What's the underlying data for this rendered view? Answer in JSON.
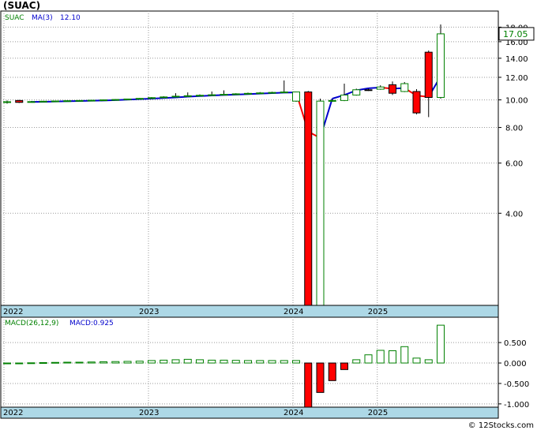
{
  "title": "(SUAC)",
  "watermark": "© 12Stocks.com",
  "colors": {
    "up_fill": "#ffffff",
    "up_stroke": "#008000",
    "down_fill": "#ff0000",
    "ma_up": "#0000cc",
    "ma_down": "#ff0000",
    "macd_pos": "#008000",
    "macd_neg": "#ff0000",
    "axis_band": "#add8e6",
    "price_badge": "#008000"
  },
  "chart_data": [
    {
      "type": "candlestick",
      "name": "price",
      "legend": {
        "ticker": "SUAC",
        "ma_label": "MA(3)",
        "ma_value": "12.10"
      },
      "last_price_label": "17.05",
      "y_scale": "log",
      "ylim": [
        1.9,
        20.5
      ],
      "yticks": [
        4.0,
        6.0,
        8.0,
        10.0,
        12.0,
        14.0,
        16.0,
        18.0
      ],
      "ytick_labels": [
        "4.00",
        "6.00",
        "8.00",
        "10.00",
        "12.00",
        "14.00",
        "16.00",
        "18.00"
      ],
      "grid": true,
      "xtick_labels": [
        "2022",
        "2023",
        "2024",
        "2025"
      ],
      "xtick_index": [
        0,
        12,
        24,
        31
      ],
      "candles": [
        {
          "o": 9.8,
          "h": 9.95,
          "l": 9.7,
          "c": 9.85
        },
        {
          "o": 9.95,
          "h": 10.0,
          "l": 9.75,
          "c": 9.8
        },
        {
          "o": 9.85,
          "h": 9.9,
          "l": 9.8,
          "c": 9.86
        },
        {
          "o": 9.87,
          "h": 9.92,
          "l": 9.84,
          "c": 9.89
        },
        {
          "o": 9.89,
          "h": 9.94,
          "l": 9.86,
          "c": 9.91
        },
        {
          "o": 9.91,
          "h": 9.96,
          "l": 9.88,
          "c": 9.93
        },
        {
          "o": 9.93,
          "h": 9.98,
          "l": 9.9,
          "c": 9.95
        },
        {
          "o": 9.95,
          "h": 10.0,
          "l": 9.92,
          "c": 9.97
        },
        {
          "o": 9.97,
          "h": 10.03,
          "l": 9.94,
          "c": 10.0
        },
        {
          "o": 10.0,
          "h": 10.06,
          "l": 9.97,
          "c": 10.03
        },
        {
          "o": 10.03,
          "h": 10.1,
          "l": 10.0,
          "c": 10.07
        },
        {
          "o": 10.07,
          "h": 10.15,
          "l": 10.04,
          "c": 10.12
        },
        {
          "o": 10.12,
          "h": 10.22,
          "l": 10.08,
          "c": 10.18
        },
        {
          "o": 10.18,
          "h": 10.3,
          "l": 10.14,
          "c": 10.24
        },
        {
          "o": 10.24,
          "h": 10.55,
          "l": 10.2,
          "c": 10.3
        },
        {
          "o": 10.3,
          "h": 10.62,
          "l": 10.26,
          "c": 10.34
        },
        {
          "o": 10.34,
          "h": 10.45,
          "l": 10.3,
          "c": 10.38
        },
        {
          "o": 10.38,
          "h": 10.7,
          "l": 10.34,
          "c": 10.42
        },
        {
          "o": 10.42,
          "h": 10.8,
          "l": 10.38,
          "c": 10.46
        },
        {
          "o": 10.46,
          "h": 10.55,
          "l": 10.42,
          "c": 10.5
        },
        {
          "o": 10.5,
          "h": 10.6,
          "l": 10.46,
          "c": 10.54
        },
        {
          "o": 10.54,
          "h": 10.65,
          "l": 10.5,
          "c": 10.58
        },
        {
          "o": 10.58,
          "h": 10.68,
          "l": 10.54,
          "c": 10.62
        },
        {
          "o": 10.62,
          "h": 11.7,
          "l": 10.58,
          "c": 10.66
        },
        {
          "o": 9.9,
          "h": 10.7,
          "l": 9.85,
          "c": 10.66
        },
        {
          "o": 10.66,
          "h": 10.75,
          "l": 1.9,
          "c": 1.9
        },
        {
          "o": 1.9,
          "h": 10.1,
          "l": 1.9,
          "c": 9.9
        },
        {
          "o": 9.9,
          "h": 10.05,
          "l": 9.85,
          "c": 9.95
        },
        {
          "o": 9.95,
          "h": 11.4,
          "l": 9.9,
          "c": 10.4
        },
        {
          "o": 10.4,
          "h": 10.95,
          "l": 10.35,
          "c": 10.85
        },
        {
          "o": 10.85,
          "h": 10.95,
          "l": 10.75,
          "c": 10.8
        },
        {
          "o": 10.9,
          "h": 11.25,
          "l": 10.85,
          "c": 11.1
        },
        {
          "o": 11.3,
          "h": 11.6,
          "l": 10.4,
          "c": 10.55
        },
        {
          "o": 10.7,
          "h": 11.55,
          "l": 10.65,
          "c": 11.4
        },
        {
          "o": 10.7,
          "h": 10.9,
          "l": 8.9,
          "c": 9.0
        },
        {
          "o": 14.7,
          "h": 14.9,
          "l": 8.7,
          "c": 10.2
        },
        {
          "o": 10.2,
          "h": 18.4,
          "l": 10.1,
          "c": 17.05
        }
      ],
      "ma": [
        null,
        null,
        9.84,
        9.85,
        9.87,
        9.89,
        9.91,
        9.93,
        9.95,
        9.98,
        10.02,
        10.06,
        10.1,
        10.15,
        10.2,
        10.26,
        10.31,
        10.36,
        10.4,
        10.44,
        10.48,
        10.52,
        10.56,
        10.6,
        10.62,
        7.74,
        7.35,
        10.1,
        10.4,
        10.8,
        10.98,
        11.05,
        10.95,
        11.0,
        10.35,
        10.25,
        12.1
      ]
    },
    {
      "type": "bar",
      "name": "macd",
      "legend": {
        "label": "MACD(26,12,9)",
        "value_label": "MACD:0.925"
      },
      "ylim": [
        -1.08,
        1.12
      ],
      "yticks": [
        -1.0,
        -0.5,
        0.0,
        0.5
      ],
      "ytick_labels": [
        "-1.000",
        "-0.500",
        "0.000",
        "0.500"
      ],
      "grid": true,
      "xtick_labels": [
        "2022",
        "2023",
        "2024",
        "2025"
      ],
      "xtick_index": [
        0,
        12,
        24,
        31
      ],
      "values": [
        0.0,
        0.0,
        0.005,
        0.01,
        0.015,
        0.02,
        0.02,
        0.025,
        0.03,
        0.035,
        0.04,
        0.045,
        0.06,
        0.07,
        0.08,
        0.09,
        0.08,
        0.07,
        0.07,
        0.065,
        0.06,
        0.06,
        0.06,
        0.06,
        0.06,
        -1.08,
        -0.72,
        -0.43,
        -0.16,
        0.08,
        0.2,
        0.31,
        0.3,
        0.4,
        0.12,
        0.08,
        0.925
      ]
    }
  ]
}
